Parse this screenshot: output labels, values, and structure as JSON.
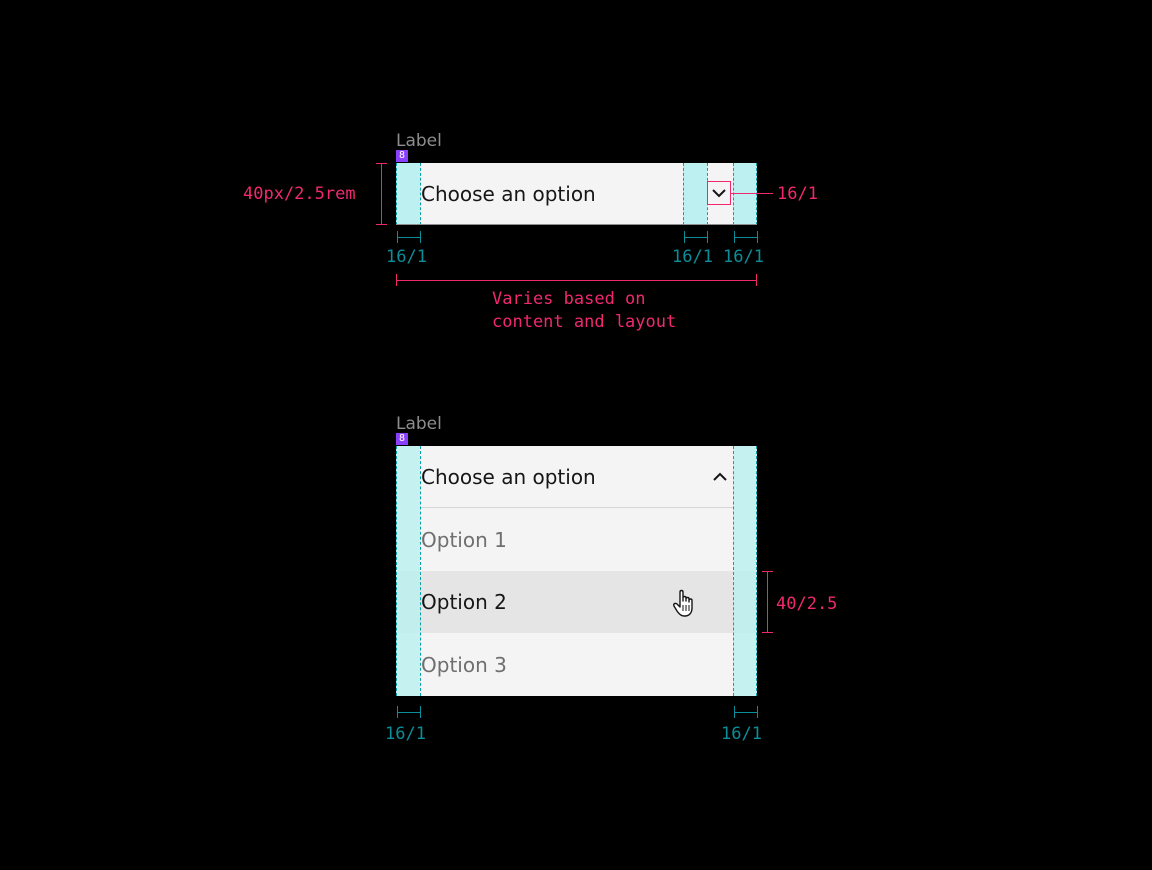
{
  "closed_select": {
    "label": "Label",
    "spacing_badge": "8",
    "placeholder": "Choose an option",
    "chevron_icon": "chevron-down-icon"
  },
  "open_select": {
    "label": "Label",
    "spacing_badge": "8",
    "placeholder": "Choose an option",
    "chevron_icon": "chevron-up-icon",
    "options": [
      "Option 1",
      "Option 2",
      "Option 3"
    ],
    "hovered_option": "Option 2"
  },
  "annotations": {
    "height": "40px/2.5rem",
    "icon_size": "16/1",
    "padding_left": "16/1",
    "padding_icon": "16/1",
    "padding_right": "16/1",
    "width_note_line1": "Varies based on",
    "width_note_line2": "content and layout",
    "menu_item_height": "40/2.5",
    "menu_padding_left": "16/1",
    "menu_padding_right": "16/1"
  },
  "colors": {
    "background": "#000000",
    "field": "#f4f4f4",
    "padding_highlight": "#bdf0f0",
    "spec_pink": "#f0296f",
    "spec_teal": "#0b8e99",
    "badge_purple": "#8a3ffc"
  }
}
